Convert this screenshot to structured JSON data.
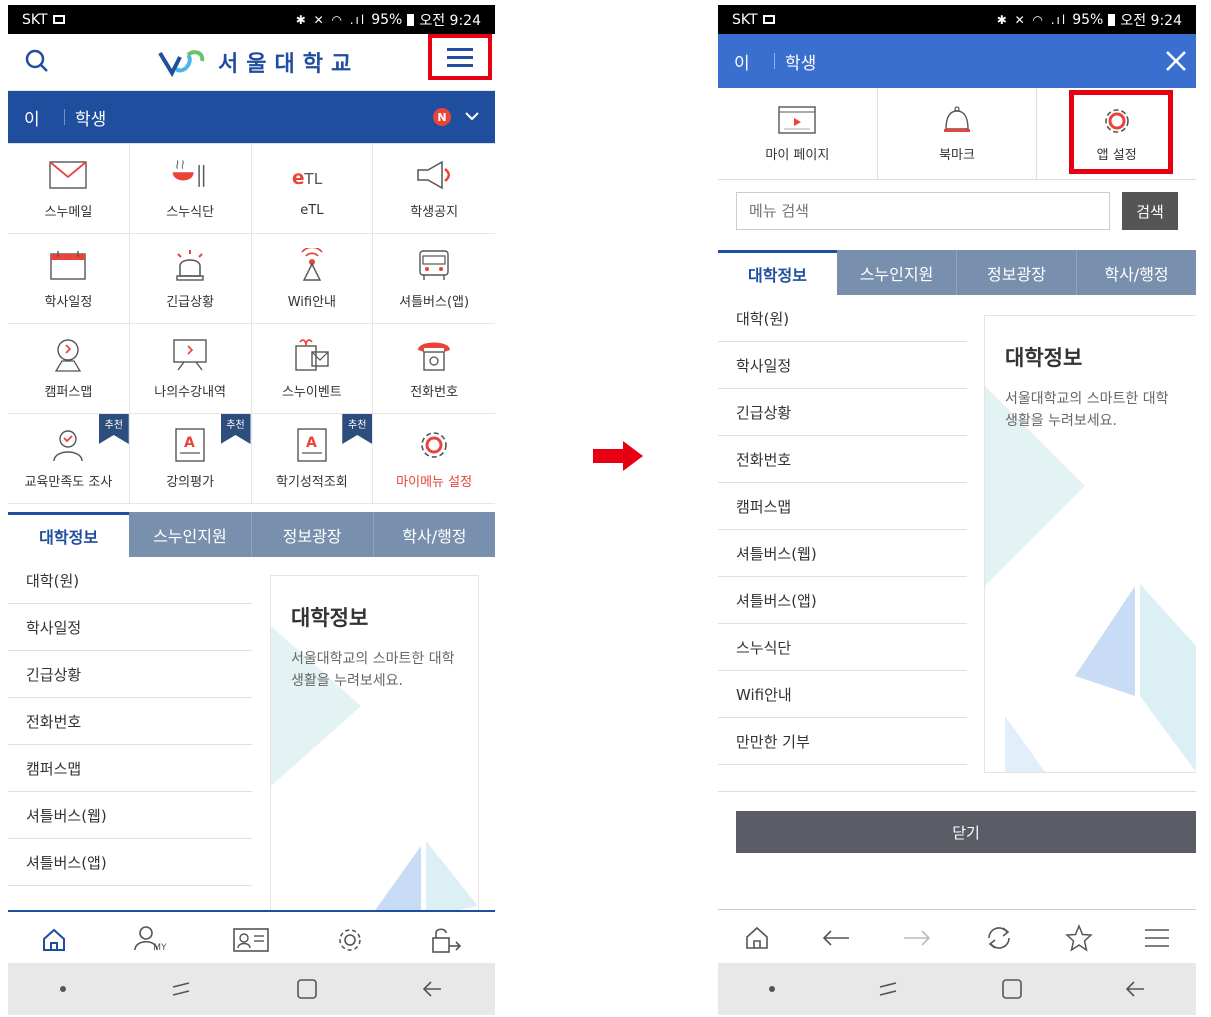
{
  "left": {
    "status": {
      "carrier": "SKT",
      "battery": "95%",
      "time": "오전 9:24"
    },
    "header": {
      "logo_text": "서울대학교"
    },
    "user": {
      "name": "이",
      "role": "학생",
      "badge": "N"
    },
    "grid": [
      {
        "label": "스누메일",
        "icon": "mail-icon"
      },
      {
        "label": "스누식단",
        "icon": "meal-icon"
      },
      {
        "label": "eTL",
        "icon": "etl-icon"
      },
      {
        "label": "학생공지",
        "icon": "megaphone-icon"
      },
      {
        "label": "학사일정",
        "icon": "calendar-icon"
      },
      {
        "label": "긴급상황",
        "icon": "alarm-icon"
      },
      {
        "label": "Wifi안내",
        "icon": "wifi-icon"
      },
      {
        "label": "셔틀버스(앱)",
        "icon": "bus-icon"
      },
      {
        "label": "캠퍼스맵",
        "icon": "map-pin-icon"
      },
      {
        "label": "나의수강내역",
        "icon": "lecture-icon"
      },
      {
        "label": "스누이벤트",
        "icon": "event-icon"
      },
      {
        "label": "전화번호",
        "icon": "phone-icon"
      },
      {
        "label": "교육만족도 조사",
        "icon": "survey-icon",
        "badge": "추천"
      },
      {
        "label": "강의평가",
        "icon": "evaluation-icon",
        "badge": "추천"
      },
      {
        "label": "학기성적조회",
        "icon": "grade-icon",
        "badge": "추천"
      },
      {
        "label": "마이메뉴 설정",
        "icon": "gear-icon",
        "highlight": true
      }
    ],
    "tabs": [
      "대학정보",
      "스누인지원",
      "정보광장",
      "학사/행정"
    ],
    "list": [
      "대학(원)",
      "학사일정",
      "긴급상황",
      "전화번호",
      "캠퍼스맵",
      "셔틀버스(웹)",
      "셔틀버스(앱)"
    ],
    "card": {
      "title": "대학정보",
      "desc": "서울대학교의 스마트한 대학생활을 누려보세요."
    },
    "bottom_nav": [
      "home-icon",
      "my-icon",
      "id-card-icon",
      "settings-icon",
      "logout-icon"
    ],
    "bottom_nav_my_label": "MY"
  },
  "right": {
    "status": {
      "carrier": "SKT",
      "battery": "95%",
      "time": "오전 9:24"
    },
    "user": {
      "name": "이",
      "role": "학생"
    },
    "quick": [
      {
        "label": "마이 페이지",
        "icon": "my-page-icon"
      },
      {
        "label": "북마크",
        "icon": "bell-icon"
      },
      {
        "label": "앱 설정",
        "icon": "gear-icon"
      }
    ],
    "search": {
      "placeholder": "메뉴 검색",
      "button": "검색"
    },
    "tabs": [
      "대학정보",
      "스누인지원",
      "정보광장",
      "학사/행정"
    ],
    "list": [
      "대학(원)",
      "학사일정",
      "긴급상황",
      "전화번호",
      "캠퍼스맵",
      "셔틀버스(웹)",
      "셔틀버스(앱)",
      "스누식단",
      "Wifi안내",
      "만만한 기부"
    ],
    "card": {
      "title": "대학정보",
      "desc": "서울대학교의 스마트한 대학생활을 누려보세요."
    },
    "close_button": "닫기",
    "browser_nav": [
      "home-icon",
      "back-icon",
      "forward-icon",
      "refresh-icon",
      "star-icon",
      "menu-icon"
    ]
  },
  "colors": {
    "brand": "#1f4e9e",
    "highlight": "#e60012",
    "alert": "#e8443a"
  }
}
